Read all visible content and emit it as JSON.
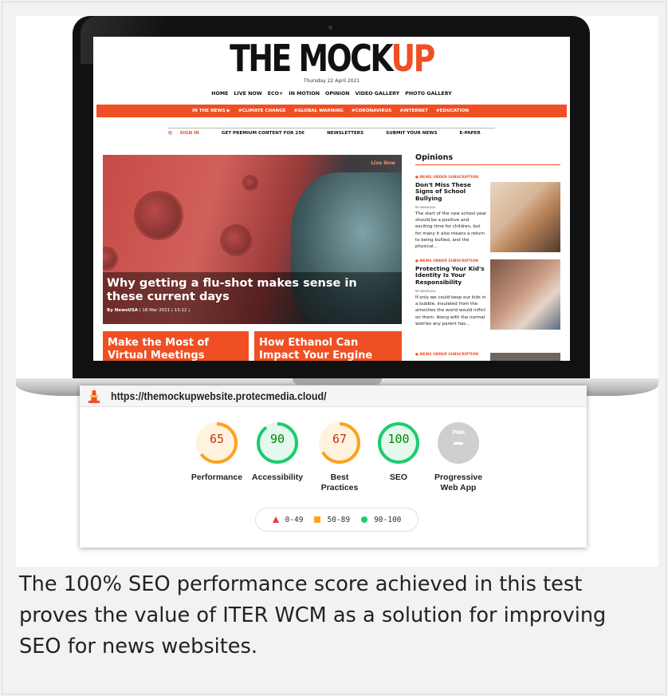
{
  "website": {
    "masthead_main": "THE MOCK",
    "masthead_accent": "UP",
    "date": "Thursday 22 April 2021",
    "nav": [
      "HOME",
      "LIVE NOW",
      "ECO+",
      "IN MOTION",
      "OPINION",
      "VIDEO GALLERY",
      "PHOTO GALLERY"
    ],
    "in_the_news": "IN THE NEWS ▶",
    "topics": [
      "#CLIMATE CHANGE",
      "#GLOBAL WARNING",
      "#CORONAVIRUS",
      "#INTERNET",
      "#EDUCATION"
    ],
    "user_bar": {
      "search_icon": "Q",
      "sign_in": "SIGN IN",
      "premium": "GET PREMIUM CONTENT FOR 25€",
      "newsletters": "NEWSLETTERS",
      "submit": "SUBMIT YOUR NEWS",
      "epaper": "E-PAPER"
    },
    "hero": {
      "live_label": "Live Now",
      "title": "Why getting a flu-shot makes sense in these current days",
      "author": "By NewsUSA",
      "date": "| 18 Mar 2021 | 13:12 |"
    },
    "cards": [
      {
        "title": "Make the Most of Virtual Meetings"
      },
      {
        "title": "How Ethanol Can Impact Your Engine"
      }
    ],
    "opinions": {
      "heading": "Opinions",
      "items": [
        {
          "tag": "● NEWS UNDER SUBSCRIPTION",
          "title": "Don't Miss These Signs of School Bullying",
          "byline": "BY NEWSUSA",
          "text": "The start of the new school year should be a positive and exciting time for children, but for many it also means a return to being bullied, and the physical..."
        },
        {
          "tag": "● NEWS UNDER SUBSCRIPTION",
          "title": "Protecting Your Kid's Identity Is Your Responsibility",
          "byline": "BY NEWSUSA",
          "text": "If only we could keep our kids in a bubble, insulated from the atrocities the world would inflict on them. Along with the normal worries any parent has..."
        },
        {
          "tag": "● NEWS UNDER SUBSCRIPTION"
        }
      ]
    }
  },
  "lighthouse": {
    "url": "https://themockupwebsite.protecmedia.cloud/",
    "colors": {
      "average": "#fea21d",
      "pass": "#1ccc6e",
      "fail": "#eb3a33",
      "na": "#cfcfcf"
    },
    "scores": [
      {
        "label": "Performance",
        "value": "65",
        "score": 65,
        "status": "average"
      },
      {
        "label": "Accessibility",
        "value": "90",
        "score": 90,
        "status": "pass"
      },
      {
        "label": "Best Practices",
        "value": "67",
        "score": 67,
        "status": "average"
      },
      {
        "label": "SEO",
        "value": "100",
        "score": 100,
        "status": "pass"
      },
      {
        "label": "Progressive Web App",
        "value": "",
        "score": 0,
        "status": "na",
        "badge": "PWA"
      }
    ],
    "legend": [
      {
        "range": "0-49",
        "icon": "triangle-icon"
      },
      {
        "range": "50-89",
        "icon": "square-icon"
      },
      {
        "range": "90-100",
        "icon": "circle-icon"
      }
    ]
  },
  "caption": "The 100% SEO performance score achieved in this test proves the value of ITER WCM as a solution for improving SEO for news websites."
}
